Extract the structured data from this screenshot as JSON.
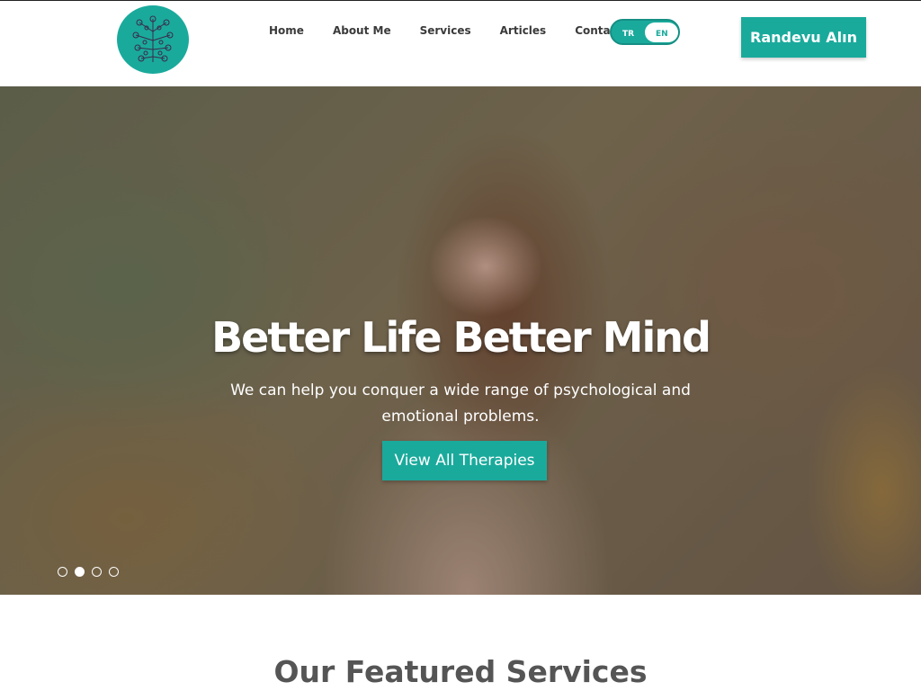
{
  "header": {
    "nav": [
      "Home",
      "About Me",
      "Services",
      "Articles",
      "Contact Me"
    ],
    "lang": {
      "tr": "TR",
      "en": "EN",
      "selected": "EN"
    },
    "cta": "Randevu Alın"
  },
  "hero": {
    "title": "Better Life Better Mind",
    "subtitle": "We can help you conquer a wide range of psychological and emotional problems.",
    "button": "View All Therapies",
    "slides": {
      "count": 4,
      "active_index": 1
    }
  },
  "featured": {
    "title": "Our Featured Services"
  },
  "colors": {
    "accent": "#1aaa9c",
    "nav_text": "#3a3a3a",
    "heading": "#555555"
  }
}
